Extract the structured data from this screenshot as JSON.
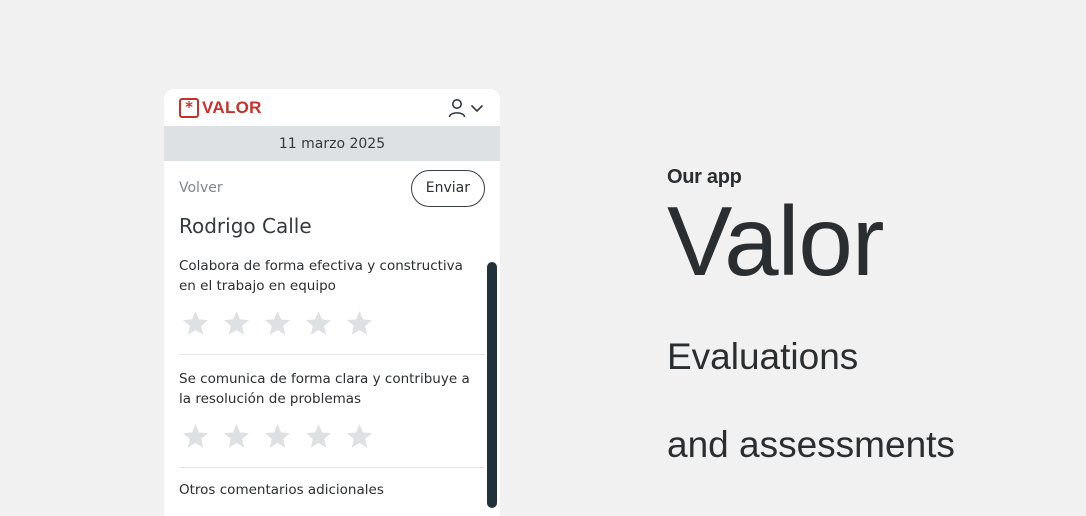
{
  "app": {
    "logo_text": "VALOR",
    "logo_mark": "*",
    "brand_color": "#c8302b"
  },
  "header": {
    "user_icon": "user-icon",
    "dropdown_icon": "chevron-down-icon"
  },
  "date": "11 marzo 2025",
  "topbar": {
    "back_label": "Volver",
    "send_label": "Enviar"
  },
  "person": {
    "name": "Rodrigo Calle"
  },
  "questions": [
    {
      "text": "Colabora de forma efectiva y constructiva en el trabajo en equipo",
      "rating": 0,
      "max": 5
    },
    {
      "text": "Se comunica de forma clara y contribuye a la resolución de problemas",
      "rating": 0,
      "max": 5
    }
  ],
  "comments_label": "Otros comentarios adicionales",
  "promo": {
    "eyebrow": "Our app",
    "title": "Valor",
    "subtitle_line1": "Evaluations",
    "subtitle_line2": "and assessments"
  },
  "colors": {
    "background": "#f2f1f1",
    "star_empty": "#dde1e3",
    "scrollbar": "#22323a"
  }
}
